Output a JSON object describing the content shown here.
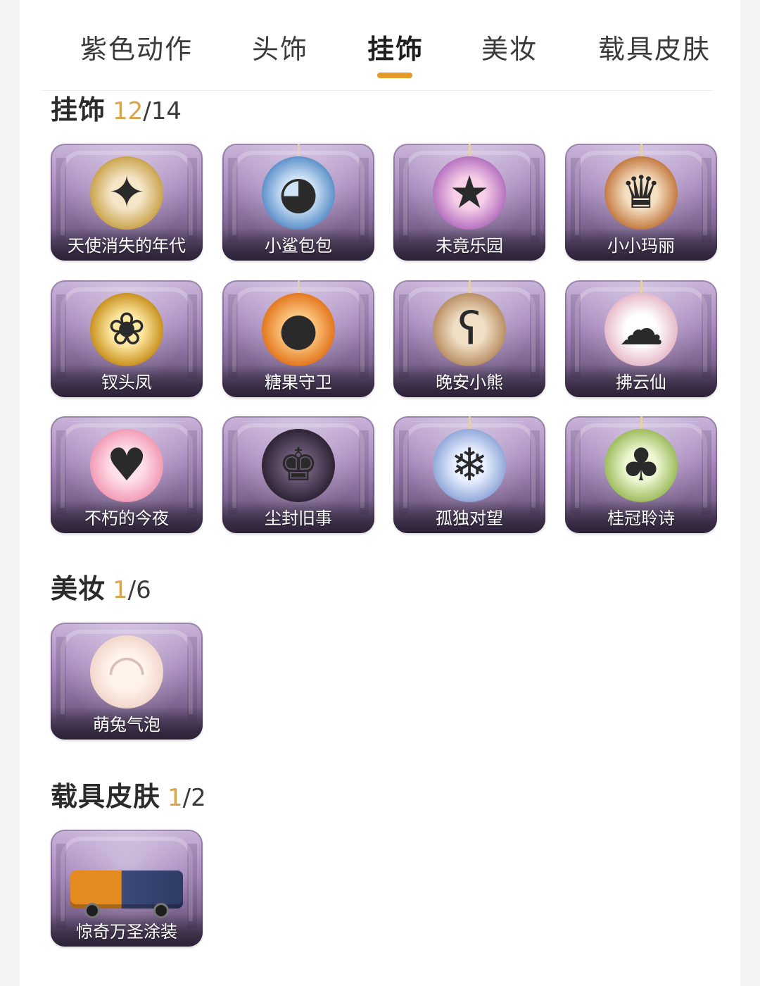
{
  "tabs": [
    {
      "label": "紫色动作",
      "active": false
    },
    {
      "label": "头饰",
      "active": false
    },
    {
      "label": "挂饰",
      "active": true
    },
    {
      "label": "美妆",
      "active": false
    },
    {
      "label": "载具皮肤",
      "active": false
    }
  ],
  "colors": {
    "accent": "#e59a2a",
    "owned_count": "#d8a24e"
  },
  "sections": [
    {
      "title": "挂饰",
      "owned": "12",
      "total": "/14",
      "items": [
        {
          "name": "天使消失的年代",
          "icon": "angel-pendant-icon"
        },
        {
          "name": "小鲨包包",
          "icon": "shark-bag-icon"
        },
        {
          "name": "未竟乐园",
          "icon": "park-doll-icon"
        },
        {
          "name": "小小玛丽",
          "icon": "mary-doll-icon"
        },
        {
          "name": "钗头凤",
          "icon": "phoenix-hairpin-icon"
        },
        {
          "name": "糖果守卫",
          "icon": "candy-pumpkin-icon"
        },
        {
          "name": "晚安小熊",
          "icon": "teddy-bear-icon"
        },
        {
          "name": "拂云仙",
          "icon": "cloud-fairy-icon"
        },
        {
          "name": "不朽的今夜",
          "icon": "pink-fox-icon"
        },
        {
          "name": "尘封旧事",
          "icon": "dark-prince-icon"
        },
        {
          "name": "孤独对望",
          "icon": "lonely-gaze-icon"
        },
        {
          "name": "桂冠聆诗",
          "icon": "laurel-poet-icon"
        }
      ]
    },
    {
      "title": "美妆",
      "owned": "1",
      "total": "/6",
      "items": [
        {
          "name": "萌兔气泡",
          "icon": "bunny-bubble-icon"
        }
      ]
    },
    {
      "title": "载具皮肤",
      "owned": "1",
      "total": "/2",
      "items": [
        {
          "name": "惊奇万圣涂装",
          "icon": "halloween-truck-icon"
        }
      ]
    }
  ]
}
